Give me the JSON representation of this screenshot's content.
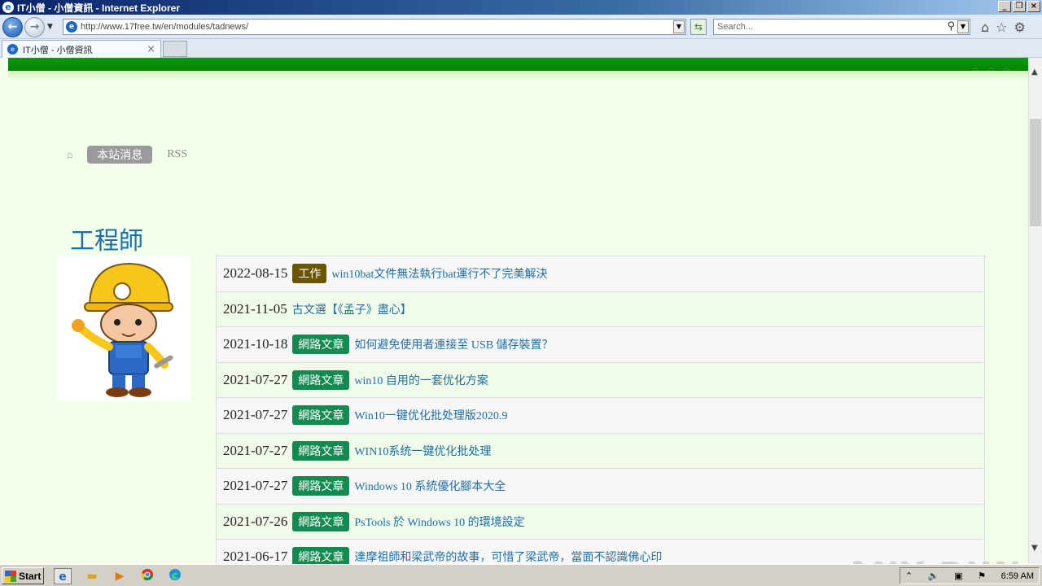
{
  "window": {
    "title": "IT小僧 - 小僧資訊 - Internet Explorer"
  },
  "address_bar": {
    "url": "http://www.17free.tw/en/modules/tadnews/"
  },
  "search": {
    "placeholder": "Search..."
  },
  "tab": {
    "label": "IT小僧 - 小僧資訊"
  },
  "breadcrumb": {
    "active": "本站消息",
    "rss": "RSS"
  },
  "section": {
    "title": "工程師"
  },
  "news": [
    {
      "date": "2022-08-15",
      "tag": "工作",
      "tag_color": "#6b5600",
      "title": "win10bat文件無法執行bat運行不了完美解決"
    },
    {
      "date": "2021-11-05",
      "tag": "",
      "tag_color": "",
      "title": "古文選【《孟子》盡心】"
    },
    {
      "date": "2021-10-18",
      "tag": "網路文章",
      "tag_color": "#138a4f",
      "title": "如何避免使用者連接至 USB 儲存裝置？"
    },
    {
      "date": "2021-07-27",
      "tag": "網路文章",
      "tag_color": "#138a4f",
      "title": "win10 自用的一套优化方案"
    },
    {
      "date": "2021-07-27",
      "tag": "網路文章",
      "tag_color": "#138a4f",
      "title": "Win10一键优化批处理版2020.9"
    },
    {
      "date": "2021-07-27",
      "tag": "網路文章",
      "tag_color": "#138a4f",
      "title": "WIN10系统一键优化批处理"
    },
    {
      "date": "2021-07-27",
      "tag": "網路文章",
      "tag_color": "#138a4f",
      "title": "Windows 10 系統優化腳本大全"
    },
    {
      "date": "2021-07-26",
      "tag": "網路文章",
      "tag_color": "#138a4f",
      "title": "PsTools 於 Windows 10 的環境設定"
    },
    {
      "date": "2021-06-17",
      "tag": "網路文章",
      "tag_color": "#138a4f",
      "title": "達摩祖師和梁武帝的故事，可惜了梁武帝，當面不認識佛心印"
    }
  ],
  "watermark": "ANY RUN",
  "taskbar": {
    "start_label": "Start",
    "clock": "6:59 AM"
  }
}
